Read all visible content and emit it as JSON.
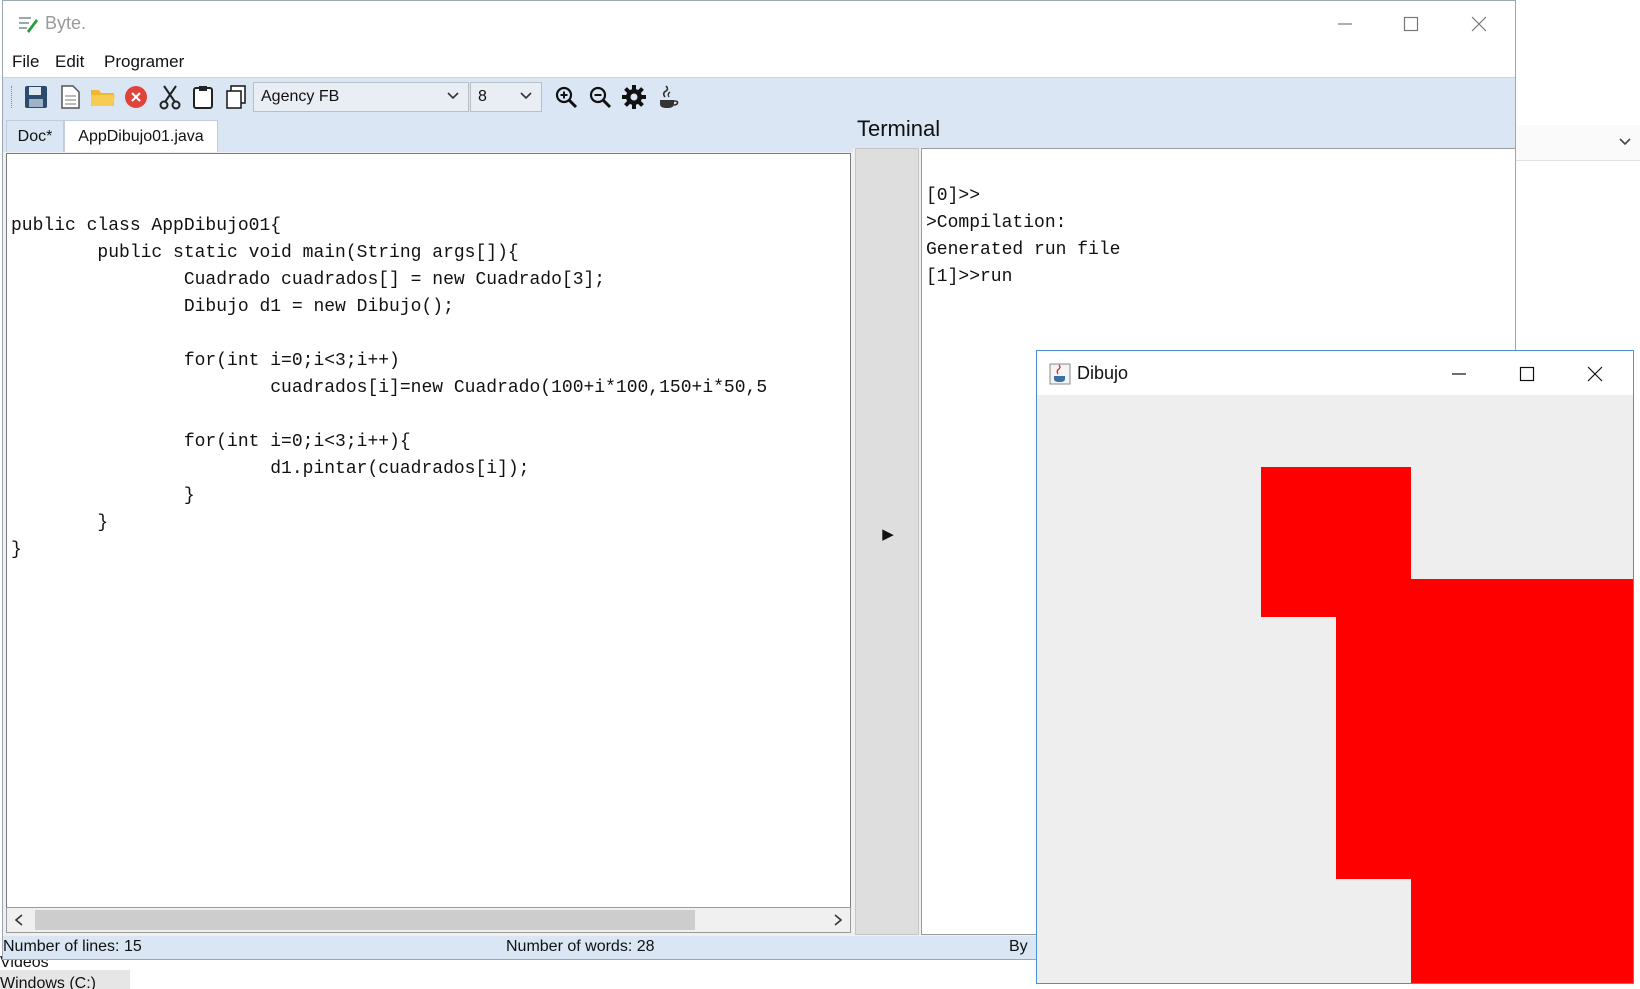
{
  "app": {
    "title": "Byte.",
    "menu": [
      "File",
      "Edit",
      "Programer"
    ]
  },
  "toolbar": {
    "font_family": "Agency FB",
    "font_size": "8",
    "icons": [
      "save-icon",
      "new-document-icon",
      "open-folder-icon",
      "stop-icon",
      "cut-icon",
      "paste-icon",
      "copy-icon",
      "zoom-in-icon",
      "zoom-out-icon",
      "settings-icon",
      "java-icon"
    ]
  },
  "tabs": [
    "Doc*",
    "AppDibujo01.java"
  ],
  "editor": {
    "lines": [
      "",
      "public class AppDibujo01{",
      "        public static void main(String args[]){",
      "                Cuadrado cuadrados[] = new Cuadrado[3];",
      "                Dibujo d1 = new Dibujo();",
      "",
      "                for(int i=0;i<3;i++)",
      "                        cuadrados[i]=new Cuadrado(100+i*100,150+i*50,5",
      "",
      "                for(int i=0;i<3;i++){",
      "                        d1.pintar(cuadrados[i]);",
      "                }",
      "        }",
      "}"
    ]
  },
  "terminal": {
    "title": "Terminal",
    "run_glyph": "▶",
    "lines": [
      "[0]>>",
      ">Compilation:",
      "Generated run file",
      "[1]>>run"
    ]
  },
  "status": {
    "lines": "Number of lines: 15",
    "words": "Number of words: 28",
    "by": "By"
  },
  "background": {
    "bottom_text_1": "Videos",
    "bottom_text_2": "Windows (C:)"
  },
  "dibujo": {
    "title": "Dibujo",
    "fill_color": "#ff0000"
  },
  "colors": {
    "toolbar_bg": "#dae6f4",
    "canvas_bg": "#eeeeee"
  }
}
